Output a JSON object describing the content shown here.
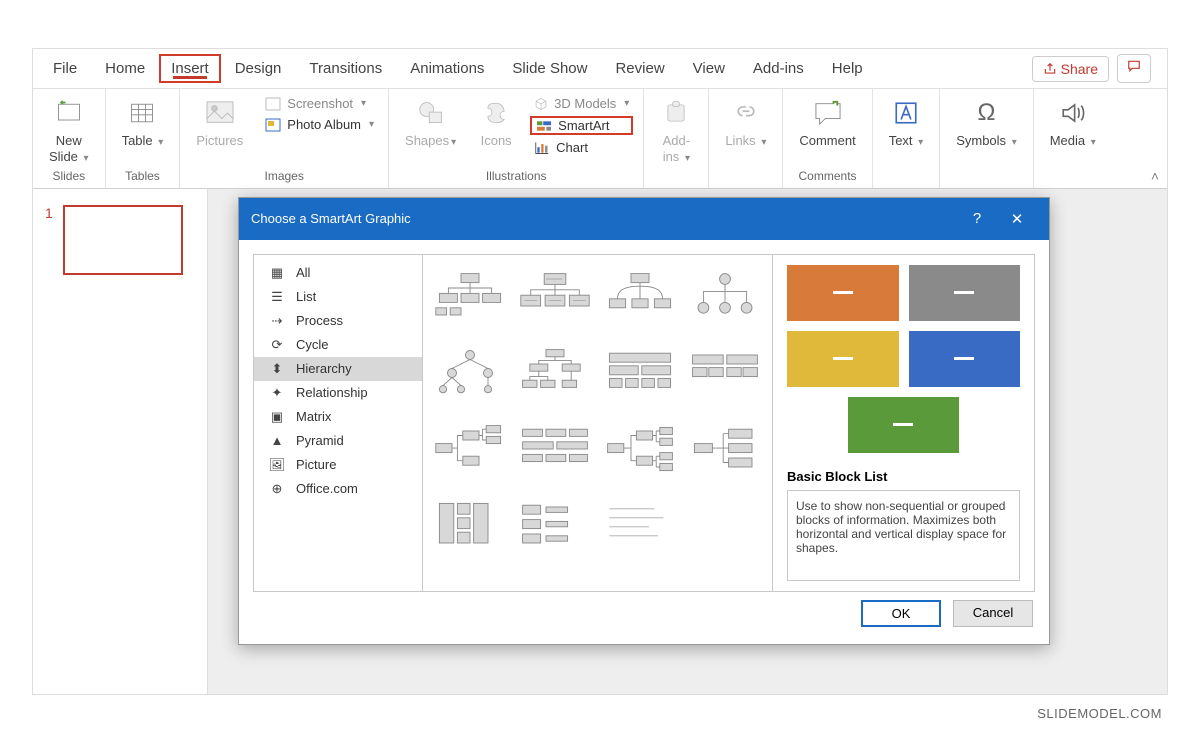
{
  "tabs": [
    "File",
    "Home",
    "Insert",
    "Design",
    "Transitions",
    "Animations",
    "Slide Show",
    "Review",
    "View",
    "Add-ins",
    "Help"
  ],
  "active_tab": "Insert",
  "share_label": "Share",
  "ribbon": {
    "new_slide": "New\nSlide",
    "table": "Table",
    "pictures": "Pictures",
    "screenshot": "Screenshot",
    "photo_album": "Photo Album",
    "shapes": "Shapes",
    "icons": "Icons",
    "models3d": "3D Models",
    "smartart": "SmartArt",
    "chart": "Chart",
    "addins": "Add-\nins",
    "links": "Links",
    "comment": "Comment",
    "text": "Text",
    "symbols": "Symbols",
    "media": "Media",
    "group_slides": "Slides",
    "group_tables": "Tables",
    "group_images": "Images",
    "group_illustrations": "Illustrations",
    "group_comments": "Comments"
  },
  "slide_number": "1",
  "dialog": {
    "title": "Choose a SmartArt Graphic",
    "categories": [
      "All",
      "List",
      "Process",
      "Cycle",
      "Hierarchy",
      "Relationship",
      "Matrix",
      "Pyramid",
      "Picture",
      "Office.com"
    ],
    "selected_category": "Hierarchy",
    "preview_title": "Basic Block List",
    "preview_desc": "Use to show non-sequential or grouped blocks of information. Maximizes both horizontal and vertical display space for shapes.",
    "preview_colors": [
      "#d77a3a",
      "#8a8a8a",
      "#e0b83a",
      "#3a6bc4",
      "#5a9a3a"
    ],
    "ok": "OK",
    "cancel": "Cancel"
  },
  "watermark": "SLIDEMODEL.COM"
}
